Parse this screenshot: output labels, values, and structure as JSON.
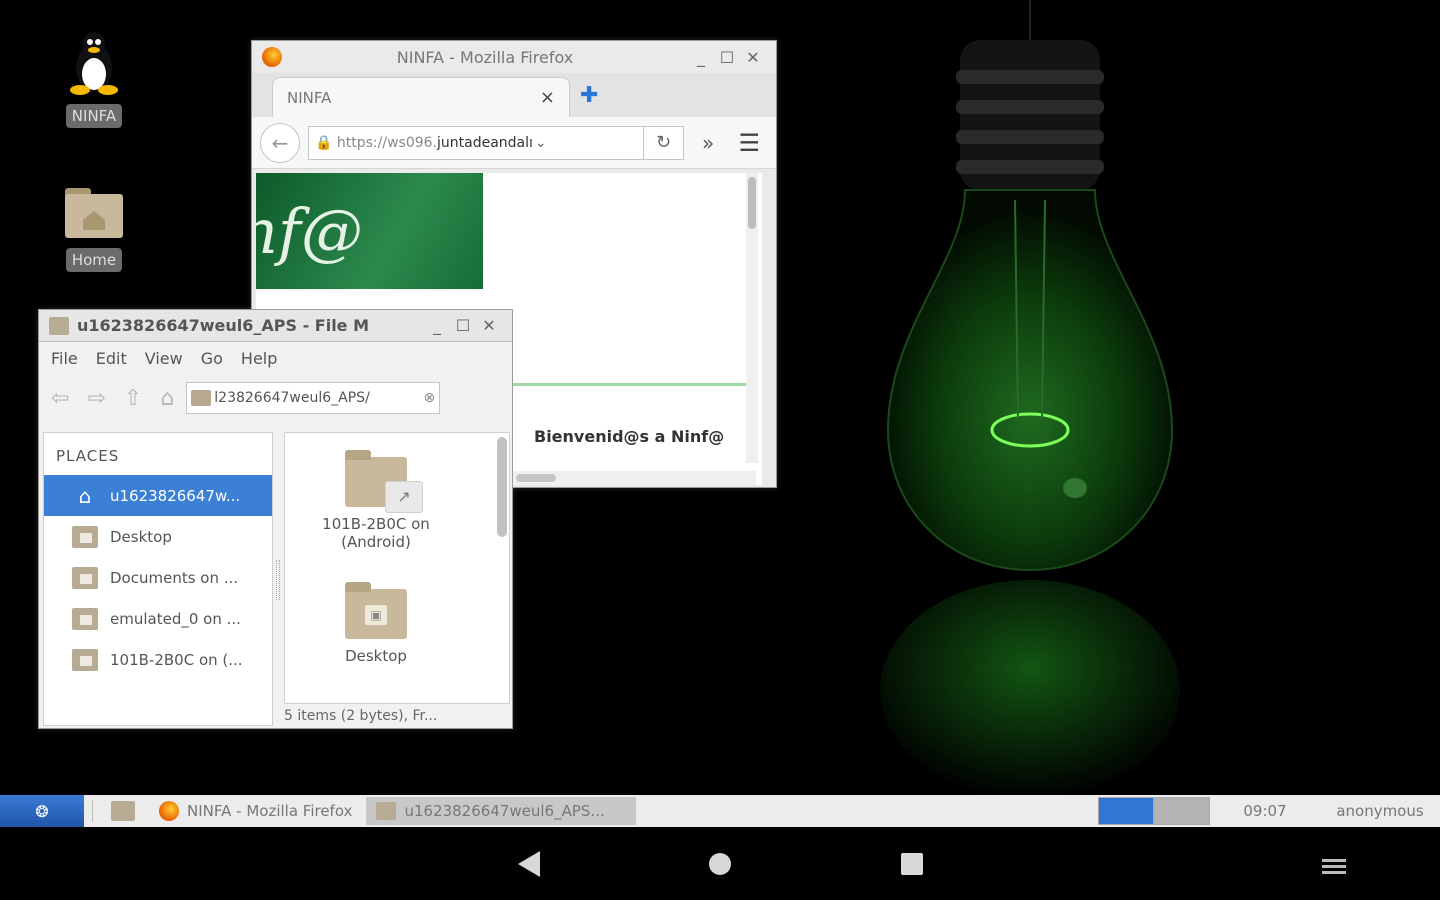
{
  "desktop": {
    "icons": [
      {
        "label": "NINFA",
        "icon": "tux-penguin-icon"
      },
      {
        "label": "Home",
        "icon": "home-folder-icon"
      }
    ]
  },
  "firefox": {
    "title": "NINFA - Mozilla Firefox",
    "tab_label": "NINFA",
    "url_prefix": "https://ws096.",
    "url_host": "juntadeandalı",
    "logo_text": "nf@",
    "welcome": "Bienvenid@s a Ninf@"
  },
  "filemanager": {
    "title": "u1623826647weul6_APS - File M",
    "menu": [
      "File",
      "Edit",
      "View",
      "Go",
      "Help"
    ],
    "path": "l23826647weul6_APS/",
    "places_header": "PLACES",
    "places": [
      {
        "label": "u1623826647w...",
        "selected": true
      },
      {
        "label": "Desktop",
        "selected": false
      },
      {
        "label": "Documents on ...",
        "selected": false
      },
      {
        "label": "emulated_0 on ...",
        "selected": false
      },
      {
        "label": "101B-2B0C on (...",
        "selected": false
      }
    ],
    "files": [
      {
        "label": "101B-2B0C on (Android)"
      },
      {
        "label": "Desktop"
      }
    ],
    "status": "5 items (2 bytes), Fr..."
  },
  "taskbar": {
    "tasks": [
      "NINFA - Mozilla Firefox",
      "u1623826647weul6_APS..."
    ],
    "clock": "09:07",
    "user": "anonymous"
  }
}
